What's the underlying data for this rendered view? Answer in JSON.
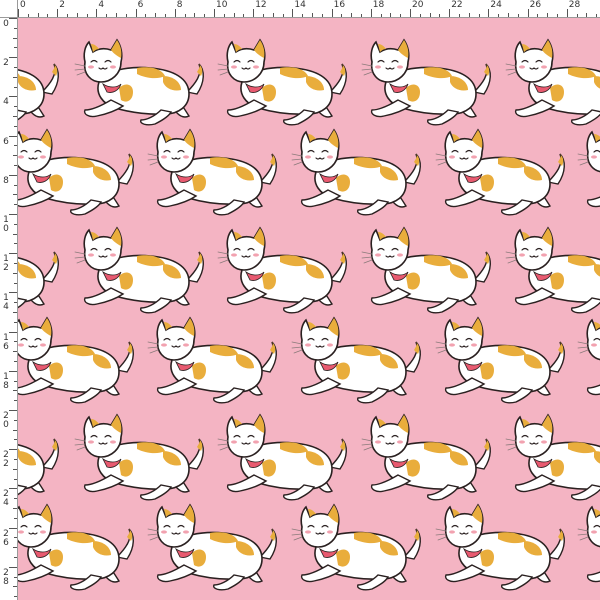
{
  "colors": {
    "background": "#f4b4c3",
    "fur": "#ffffff",
    "spots": "#e9ad3c",
    "outline": "#2a2020",
    "collar": "#e85a70",
    "cheek": "#f2a2b0",
    "ruler_bg": "#ffffff"
  },
  "ruler": {
    "unit": "inch",
    "top_labels": [
      "0",
      "2",
      "4",
      "6",
      "8",
      "10",
      "12",
      "14",
      "16",
      "18",
      "20",
      "22",
      "24",
      "26",
      "28"
    ],
    "left_labels": [
      "0",
      "2",
      "4",
      "6",
      "8",
      "10",
      "12",
      "14",
      "16",
      "18",
      "20",
      "22",
      "24",
      "26",
      "28"
    ]
  },
  "pattern": {
    "motif": "walking calico cat with collar",
    "icon": "cat-icon"
  }
}
